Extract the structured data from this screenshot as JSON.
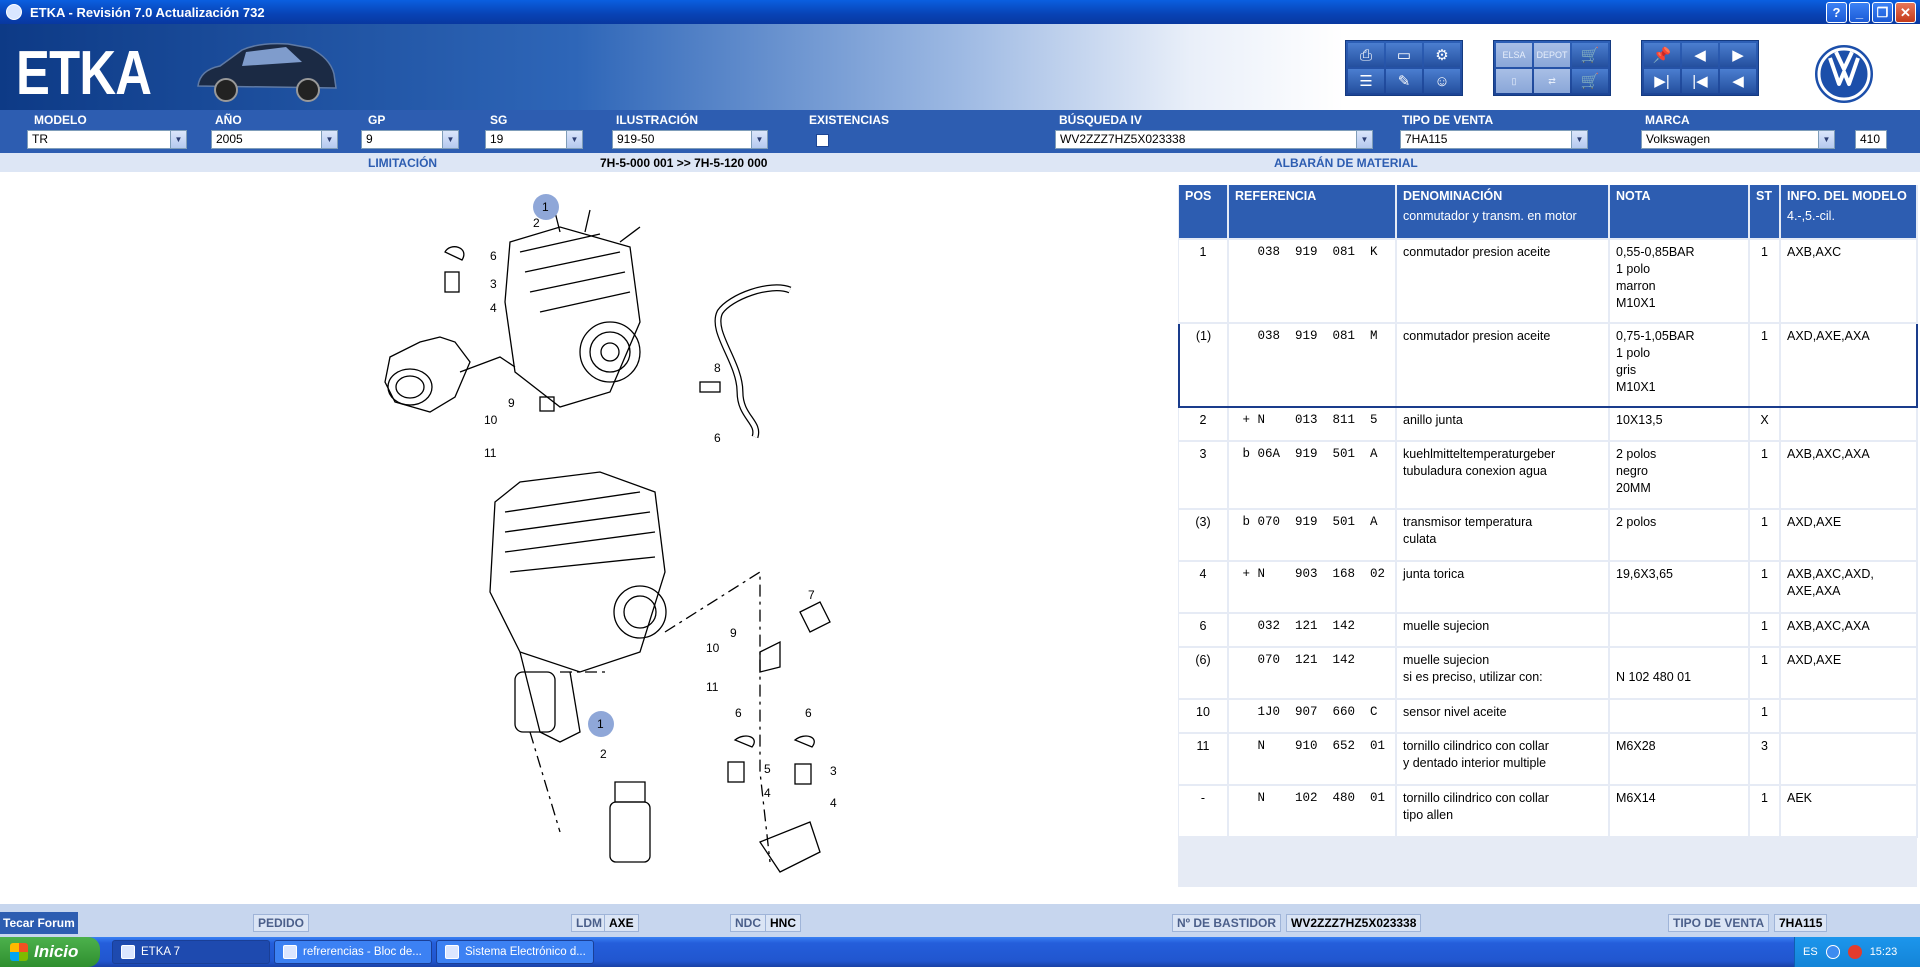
{
  "window": {
    "title": "ETKA - Revisión 7.0 Actualización 732"
  },
  "banner": {
    "logo": "ETKA"
  },
  "selection": {
    "modelo": {
      "label": "MODELO",
      "value": "TR"
    },
    "anio": {
      "label": "AÑO",
      "value": "2005"
    },
    "gp": {
      "label": "GP",
      "value": "9"
    },
    "sg": {
      "label": "SG",
      "value": "19"
    },
    "ilustracion": {
      "label": "ILUSTRACIÓN",
      "value": "919-50"
    },
    "existencias": {
      "label": "EXISTENCIAS"
    },
    "busqueda": {
      "label": "BÚSQUEDA IV",
      "value": "WV2ZZZ7HZ5X023338"
    },
    "tipo_venta": {
      "label": "TIPO DE VENTA",
      "value": "7HA115"
    },
    "marca": {
      "label": "MARCA",
      "value": "Volkswagen",
      "code": "410"
    }
  },
  "limitation": {
    "label": "LIMITACIÓN",
    "range": "7H-5-000 001 >> 7H-5-120 000",
    "albaran": "ALBARÁN DE MATERIAL"
  },
  "diagram": {
    "callouts_top": [
      "1",
      "2",
      "6",
      "3",
      "4",
      "9",
      "10",
      "11",
      "8",
      "6"
    ],
    "callouts_bottom": [
      "7",
      "9",
      "10",
      "11",
      "1",
      "2",
      "6",
      "5",
      "4",
      "6",
      "3",
      "4"
    ]
  },
  "table": {
    "headers": [
      "POS",
      "REFERENCIA",
      "DENOMINACIÓN",
      "NOTA",
      "ST",
      "INFO. DEL MODELO"
    ],
    "subheader": {
      "denominacion": "conmutador y transm. en motor",
      "info": "4.-,5.-cil."
    },
    "rows": [
      {
        "pos": "1",
        "ref": "   038  919  081  K",
        "den": "conmutador presion aceite",
        "nota": "0,55-0,85BAR\n1 polo\nmarron\nM10X1",
        "st": "1",
        "info": "AXB,AXC"
      },
      {
        "pos": "(1)",
        "ref": "   038  919  081  M",
        "den": "conmutador presion aceite",
        "nota": "0,75-1,05BAR\n1 polo\ngris\nM10X1",
        "st": "1",
        "info": "AXD,AXE,AXA"
      },
      {
        "pos": "2",
        "ref": " + N    013  811  5",
        "den": "anillo junta",
        "nota": "10X13,5",
        "st": "X",
        "info": ""
      },
      {
        "pos": "3",
        "ref": " b 06A  919  501  A",
        "den": "kuehlmitteltemperaturgeber\ntubuladura conexion agua",
        "nota": "2 polos\nnegro\n20MM",
        "st": "1",
        "info": "AXB,AXC,AXA"
      },
      {
        "pos": "(3)",
        "ref": " b 070  919  501  A",
        "den": "transmisor temperatura\nculata",
        "nota": "2 polos",
        "st": "1",
        "info": "AXD,AXE"
      },
      {
        "pos": "4",
        "ref": " + N    903  168  02",
        "den": "junta torica",
        "nota": "19,6X3,65",
        "st": "1",
        "info": "AXB,AXC,AXD,\nAXE,AXA"
      },
      {
        "pos": "6",
        "ref": "   032  121  142",
        "den": "muelle sujecion",
        "nota": "",
        "st": "1",
        "info": "AXB,AXC,AXA"
      },
      {
        "pos": "(6)",
        "ref": "   070  121  142",
        "den": "muelle sujecion\n  si es preciso, utilizar con:",
        "nota": "\nN 102 480 01",
        "st": "1",
        "info": "AXD,AXE"
      },
      {
        "pos": "10",
        "ref": "   1J0  907  660  C",
        "den": "sensor nivel aceite",
        "nota": "",
        "st": "1",
        "info": ""
      },
      {
        "pos": "11",
        "ref": "   N    910  652  01",
        "den": "tornillo cilindrico con collar\ny dentado interior multiple",
        "nota": "M6X28",
        "st": "3",
        "info": ""
      },
      {
        "pos": "-",
        "ref": "   N    102  480  01",
        "den": "tornillo cilindrico con collar\ntipo allen",
        "nota": "M6X14",
        "st": "1",
        "info": "AEK"
      }
    ]
  },
  "status": {
    "forum": "Tecar Forum",
    "pedido": "PEDIDO",
    "ldm": "LDM",
    "ldm_value": "AXE",
    "ndc": "NDC",
    "ndc_value": "HNC",
    "bastidor": "Nº DE BASTIDOR",
    "bastidor_value": "WV2ZZZ7HZ5X023338",
    "tipo_venta": "TIPO DE VENTA",
    "tipo_venta_value": "7HA115"
  },
  "taskbar": {
    "start": "Inicio",
    "tasks": [
      "ETKA 7",
      "refrerencias - Bloc de...",
      "Sistema Electrónico d..."
    ],
    "lang": "ES",
    "clock": "15:23"
  },
  "colors": {
    "accent": "#2d5db1",
    "titlebar": "#0842b4",
    "highlight": "#8fa7d8"
  }
}
